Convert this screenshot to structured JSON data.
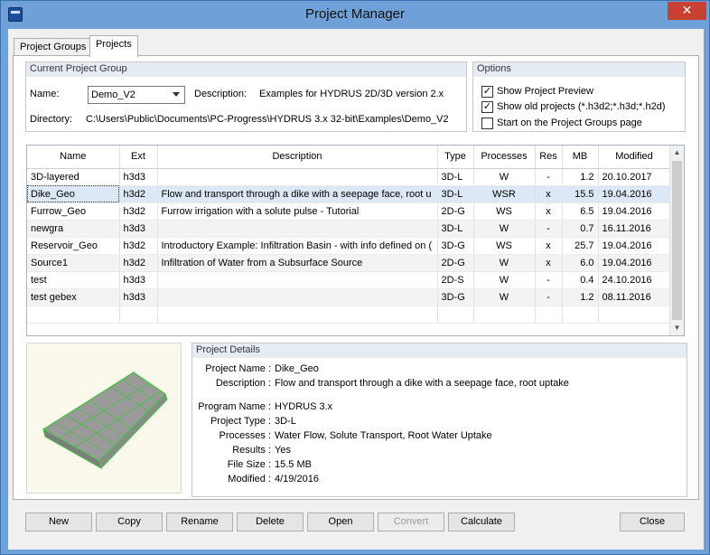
{
  "window": {
    "title": "Project Manager",
    "close_glyph": "✕"
  },
  "tabs": [
    {
      "label": "Project Groups",
      "active": false
    },
    {
      "label": "Projects",
      "active": true
    }
  ],
  "current_group": {
    "title": "Current Project Group",
    "name_label": "Name:",
    "name_value": "Demo_V2",
    "description_label": "Description:",
    "description_value": "Examples for HYDRUS 2D/3D version 2.x",
    "directory_label": "Directory:",
    "directory_value": "C:\\Users\\Public\\Documents\\PC-Progress\\HYDRUS 3.x 32-bit\\Examples\\Demo_V2"
  },
  "options": {
    "title": "Options",
    "items": [
      {
        "label": "Show Project Preview",
        "checked": true,
        "glyph": "✓"
      },
      {
        "label": "Show old projects (*.h3d2;*.h3d;*.h2d)",
        "checked": true,
        "glyph": "✓"
      },
      {
        "label": "Start on the Project Groups page",
        "checked": false,
        "glyph": ""
      }
    ]
  },
  "table": {
    "columns": [
      "Name",
      "Ext",
      "Description",
      "Type",
      "Processes",
      "Res",
      "MB",
      "Modified"
    ],
    "rows": [
      [
        "3D-layered",
        "h3d3",
        "",
        "3D-L",
        "W",
        "-",
        "1.2",
        "20.10.2017"
      ],
      [
        "Dike_Geo",
        "h3d2",
        "Flow and transport through a dike with a seepage face, root u",
        "3D-L",
        "WSR",
        "x",
        "15.5",
        "19.04.2016"
      ],
      [
        "Furrow_Geo",
        "h3d2",
        "Furrow irrigation with a solute pulse - Tutorial",
        "2D-G",
        "WS",
        "x",
        "6.5",
        "19.04.2016"
      ],
      [
        "newgra",
        "h3d3",
        "",
        "3D-L",
        "W",
        "-",
        "0.7",
        "16.11.2016"
      ],
      [
        "Reservoir_Geo",
        "h3d2",
        "Introductory Example: Infiltration Basin - with info defined on (",
        "3D-G",
        "WS",
        "x",
        "25.7",
        "19.04.2016"
      ],
      [
        "Source1",
        "h3d2",
        "Infiltration of Water from a Subsurface Source",
        "2D-G",
        "W",
        "x",
        "6.0",
        "19.04.2016"
      ],
      [
        "test",
        "h3d3",
        "",
        "2D-S",
        "W",
        "-",
        "0.4",
        "24.10.2016"
      ],
      [
        "test gebex",
        "h3d3",
        "",
        "3D-G",
        "W",
        "-",
        "1.2",
        "08.11.2016"
      ]
    ],
    "selected_row": 1,
    "scroll_up_glyph": "▲",
    "scroll_down_glyph": "▼"
  },
  "details": {
    "title": "Project Details",
    "project_name_label": "Project Name :",
    "project_name": "Dike_Geo",
    "description_label": "Description :",
    "description": "Flow and transport through a dike with a seepage face, root uptake",
    "program_label": "Program Name :",
    "program": "HYDRUS 3.x",
    "type_label": "Project Type :",
    "type": "3D-L",
    "processes_label": "Processes :",
    "processes": "Water Flow, Solute Transport, Root Water Uptake",
    "results_label": "Results :",
    "results": "Yes",
    "size_label": "File Size :",
    "size": "15.5 MB",
    "modified_label": "Modified :",
    "modified": "4/19/2016"
  },
  "buttons": {
    "new": "New",
    "copy": "Copy",
    "rename": "Rename",
    "delete": "Delete",
    "open": "Open",
    "convert": "Convert",
    "calculate": "Calculate",
    "close": "Close"
  },
  "colors": {
    "title_bar": "#6fa0d8",
    "close_button": "#c84031",
    "selected_row": "#dce8f5",
    "mesh_green": "#3fc43f"
  }
}
